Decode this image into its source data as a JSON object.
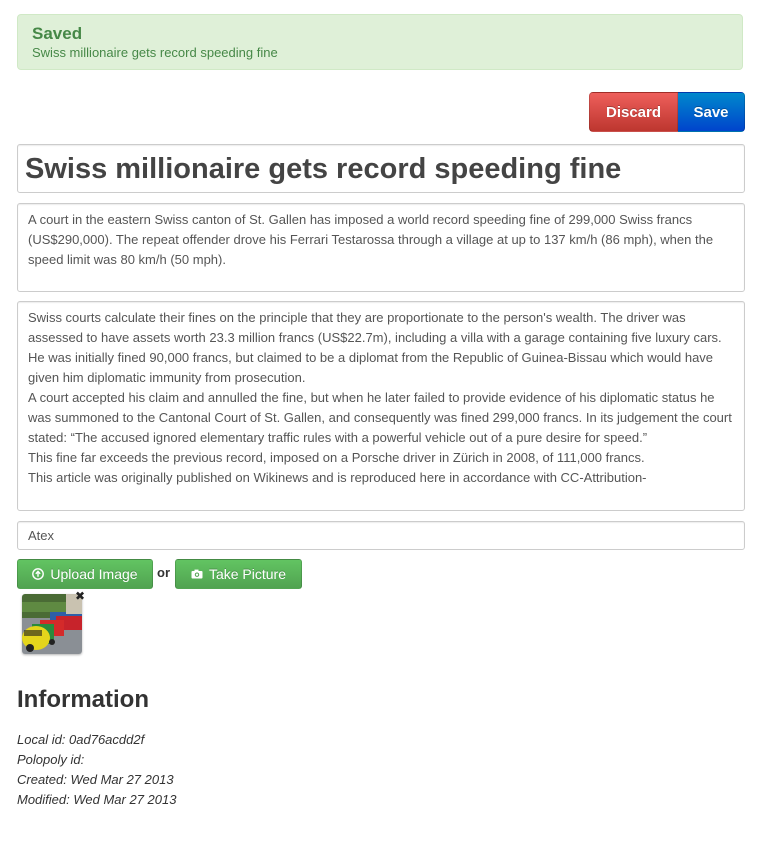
{
  "alert": {
    "title": "Saved",
    "message": "Swiss millionaire gets record speeding fine"
  },
  "toolbar": {
    "discard_label": "Discard",
    "save_label": "Save"
  },
  "article": {
    "title": "Swiss millionaire gets record speeding fine",
    "lead": "A court in the eastern Swiss canton of St. Gallen has imposed a world record speeding fine of 299,000 Swiss francs (US$290,000). The repeat offender drove his Ferrari Testarossa through a village at up to 137 km/h (86 mph), when the speed limit was 80 km/h (50 mph).",
    "body": [
      "Swiss courts calculate their fines on the principle that they are proportionate to the person's wealth. The driver was assessed to have assets worth 23.3 million francs (US$22.7m), including a villa with a garage containing five luxury cars. He was initially fined 90,000 francs, but claimed to be a diplomat from the Republic of Guinea-Bissau which would have given him diplomatic immunity from prosecution.",
      "A court accepted his claim and annulled the fine, but when he later failed to provide evidence of his diplomatic status he was summoned to the Cantonal Court of St. Gallen, and consequently was fined 299,000 francs. In its judgement the court stated: “The accused ignored elementary traffic rules with a powerful vehicle out of a pure desire for speed.”",
      "This fine far exceeds the previous record, imposed on a Porsche driver in Zürich in 2008, of 111,000 francs.",
      "This article was originally published on Wikinews and is reproduced here in accordance with CC-Attribution-"
    ],
    "byline": "Atex"
  },
  "media": {
    "upload_label": "Upload Image",
    "or_label": "or",
    "take_picture_label": "Take Picture",
    "remove_glyph": "✖"
  },
  "information": {
    "heading": "Information",
    "local_id": "Local id: 0ad76acdd2f",
    "polopoly_id": "Polopoly id:",
    "created": "Created: Wed Mar 27 2013",
    "modified": "Modified: Wed Mar 27 2013"
  },
  "colors": {
    "alert_bg": "#dff0d8",
    "alert_text": "#468847",
    "discard": "#bd362f",
    "save": "#0044cc",
    "success": "#51a351"
  }
}
